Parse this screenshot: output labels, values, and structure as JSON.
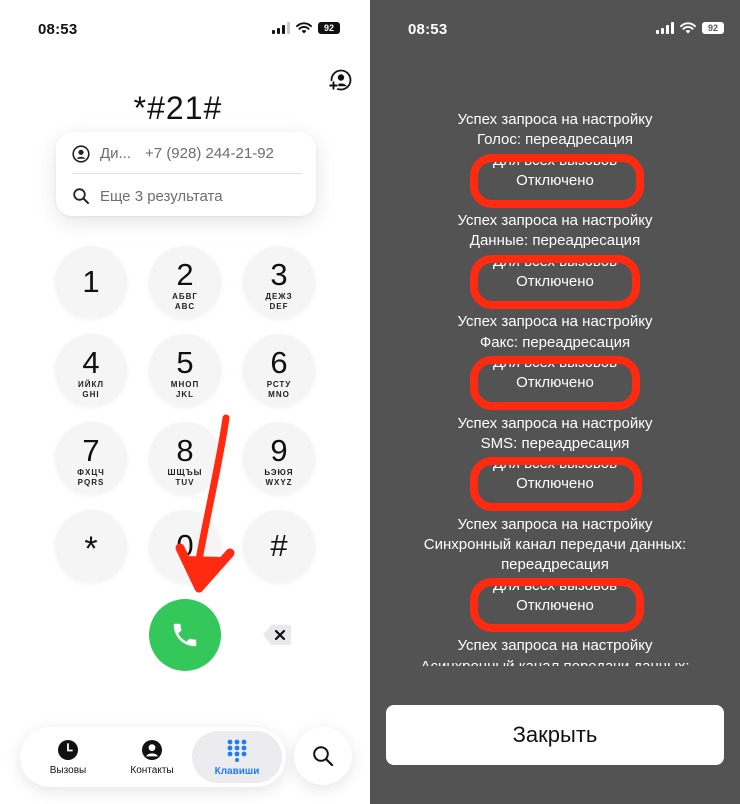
{
  "left": {
    "status": {
      "time": "08:53",
      "battery": "92"
    },
    "dialed_number": "*#21#",
    "suggestions": {
      "contact_name": "Ди...",
      "contact_number": "+7 (928) 244-21-92",
      "more_results": "Еще 3 результата"
    },
    "keypad": [
      {
        "digit": "1",
        "l1": "",
        "l2": ""
      },
      {
        "digit": "2",
        "l1": "АБВГ",
        "l2": "ABC"
      },
      {
        "digit": "3",
        "l1": "ДЕЖЗ",
        "l2": "DEF"
      },
      {
        "digit": "4",
        "l1": "ИЙКЛ",
        "l2": "GHI"
      },
      {
        "digit": "5",
        "l1": "МНОП",
        "l2": "JKL"
      },
      {
        "digit": "6",
        "l1": "РСТУ",
        "l2": "MNO"
      },
      {
        "digit": "7",
        "l1": "ФХЦЧ",
        "l2": "PQRS"
      },
      {
        "digit": "8",
        "l1": "ШЩЪЫ",
        "l2": "TUV"
      },
      {
        "digit": "9",
        "l1": "ЬЭЮЯ",
        "l2": "WXYZ"
      },
      {
        "digit": "*",
        "l1": "",
        "l2": ""
      },
      {
        "digit": "0",
        "l1": "",
        "l2": ""
      },
      {
        "digit": "#",
        "l1": "",
        "l2": ""
      }
    ],
    "tabs": [
      {
        "label": "Вызовы",
        "icon": "clock-icon"
      },
      {
        "label": "Контакты",
        "icon": "person-icon"
      },
      {
        "label": "Клавиши",
        "icon": "keypad-icon"
      }
    ],
    "colors": {
      "call_button": "#34c759",
      "accent": "#1e7cf2",
      "annotation": "#ff2a10"
    }
  },
  "right": {
    "status": {
      "time": "08:53",
      "battery": "92"
    },
    "background": "#535353",
    "blocks": [
      {
        "line1": "Успех запроса на настройку",
        "service": "Голос: переадресация",
        "scope": "Для всех вызовов",
        "state": "Отключено"
      },
      {
        "line1": "Успех запроса на настройку",
        "service": "Данные: переадресация",
        "scope": "Для всех вызовов",
        "state": "Отключено"
      },
      {
        "line1": "Успех запроса на настройку",
        "service": "Факс: переадресация",
        "scope": "Для всех вызовов",
        "state": "Отключено"
      },
      {
        "line1": "Успех запроса на настройку",
        "service": "SMS: переадресация",
        "scope": "Для всех вызовов",
        "state": "Отключено"
      },
      {
        "line1": "Успех запроса на настройку",
        "service": "Синхронный канал передачи данных:",
        "service2": "переадресация",
        "scope": "Для всех вызовов",
        "state": "Отключено"
      },
      {
        "line1": "Успех запроса на настройку",
        "service": "Асинхронный канал передачи данных:"
      }
    ],
    "close_label": "Закрыть"
  }
}
